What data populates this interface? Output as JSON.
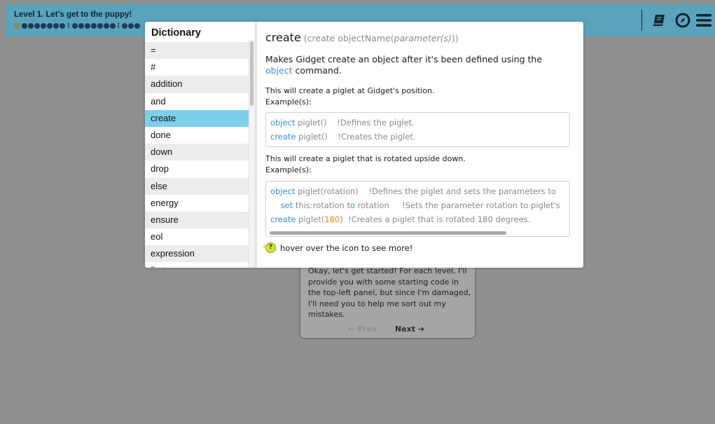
{
  "topbar": {
    "level_title": "Level 1. Let's get to the puppy!",
    "progress_groups": [
      7,
      7,
      3
    ],
    "icons": [
      "dictionary-book-icon",
      "compass-icon",
      "hamburger-menu-icon"
    ]
  },
  "dialog": {
    "text": "Okay, let's get started! For each level, I'll provide you with some starting code in the top-left panel, but since I'm damaged, I'll need you to help me sort out my mistakes.",
    "prev_label": "← Prev",
    "next_label": "Next ➔"
  },
  "dictionary": {
    "title": "Dictionary",
    "items": [
      "=",
      "#",
      "addition",
      "and",
      "create",
      "done",
      "down",
      "drop",
      "else",
      "energy",
      "ensure",
      "eol",
      "expression",
      "first"
    ],
    "selected": "create"
  },
  "entry": {
    "keyword": "create",
    "signature_prefix": " (create objectName(",
    "signature_param": "parameter(s)",
    "signature_suffix": "))",
    "desc_before": "Makes Gidget create an object after it's been defined using the ",
    "desc_link": "object",
    "desc_after": " command.",
    "examples": [
      {
        "description": "This will create a piglet at Gidget's position.",
        "label": "Example(s):",
        "lines": [
          [
            {
              "t": "object",
              "c": "k"
            },
            {
              "t": " piglet()    !Defines the piglet.",
              "c": ""
            }
          ],
          [
            {
              "t": "create",
              "c": "k"
            },
            {
              "t": " piglet()    !Creates the piglet.",
              "c": ""
            }
          ]
        ]
      },
      {
        "description": "This will create a piglet that is rotated upside down.",
        "label": "Example(s):",
        "lines": [
          [
            {
              "t": "object",
              "c": "k"
            },
            {
              "t": " piglet(rotation)    !Defines the piglet and sets the parameters to ",
              "c": ""
            }
          ],
          [
            {
              "t": "    ",
              "c": ""
            },
            {
              "t": "set",
              "c": "k"
            },
            {
              "t": " this:rotation ",
              "c": ""
            },
            {
              "t": "to",
              "c": "k"
            },
            {
              "t": " rotation     !Sets the parameter rotation to piglet's",
              "c": ""
            }
          ],
          [
            {
              "t": "create",
              "c": "k"
            },
            {
              "t": " piglet(",
              "c": ""
            },
            {
              "t": "180",
              "c": "n"
            },
            {
              "t": ")  !Creates a piglet that is rotated 180 degrees.",
              "c": ""
            }
          ]
        ]
      }
    ],
    "hover_hint": "hover over the icon to see more!",
    "hint_icon_glyph": "?"
  },
  "colors": {
    "topbar": "#5aa3bd",
    "selected_item": "#7dcfec",
    "keyword": "#3a8fd0",
    "number": "#e28b00"
  }
}
